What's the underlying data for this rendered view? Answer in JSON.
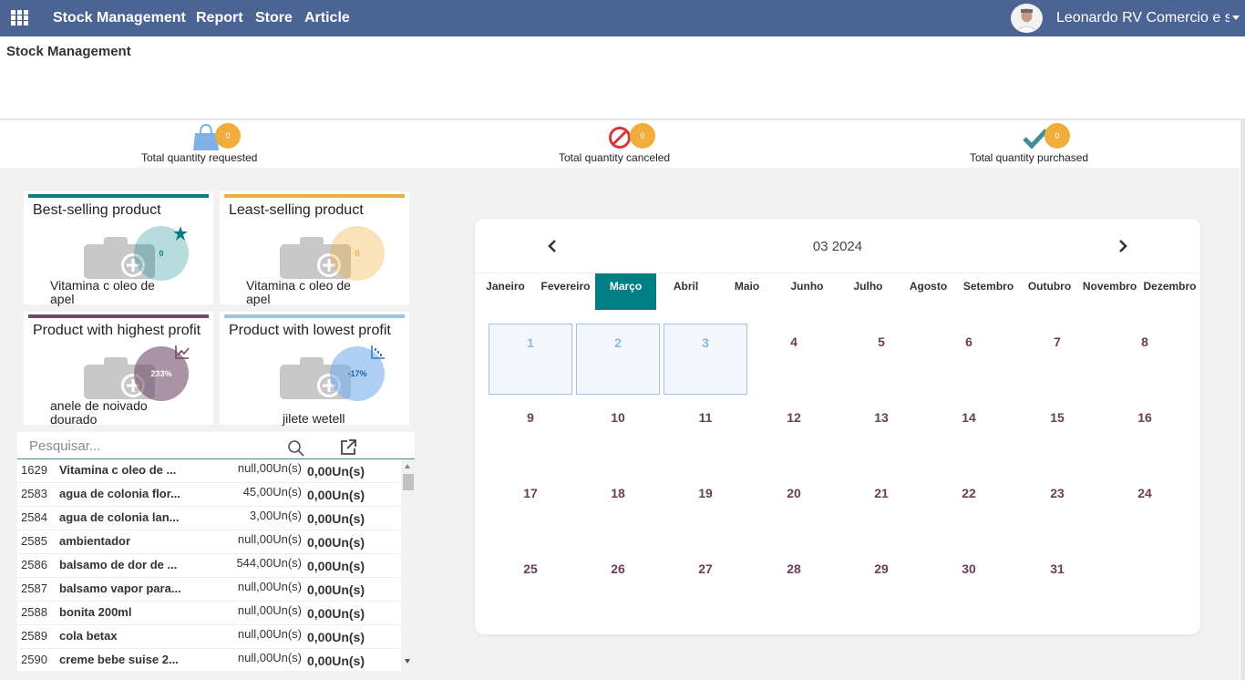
{
  "navbar": {
    "brand": "Stock Management",
    "menus": [
      "Report",
      "Store",
      "Article"
    ],
    "user": "Leonardo RV Comercio e serviços",
    "bg_color": "#4c6494"
  },
  "page": {
    "title": "Stock Management"
  },
  "kpis": [
    {
      "label": "Total quantity requested",
      "value": "0",
      "icon": "shopping-bag-icon"
    },
    {
      "label": "Total quantity canceled",
      "value": "0",
      "icon": "cancel-icon"
    },
    {
      "label": "Total quantity purchased",
      "value": "0",
      "icon": "check-icon"
    }
  ],
  "cards": [
    {
      "title": "Best-selling product",
      "value": "0",
      "product": "Vitamina c oleo de apel",
      "accent": "#017e84",
      "icon": "star-icon"
    },
    {
      "title": "Least-selling product",
      "value": "0",
      "product": "Vitamina c oleo de apel",
      "accent": "#f0ad3c"
    },
    {
      "title": "Product with highest profit",
      "value": "233%",
      "product": "anele de noivado dourado",
      "accent": "#714b67",
      "icon": "line-chart-icon"
    },
    {
      "title": "Product with lowest profit",
      "value": "-17%",
      "product": "jilete wetell",
      "accent": "#9fc3e7",
      "icon": "bar-chart-icon"
    }
  ],
  "search": {
    "placeholder": "Pesquisar..."
  },
  "products": [
    {
      "code": "1629",
      "name": "Vitamina c oleo de ...",
      "qty": "null,00Un(s)",
      "total": "0,00Un(s)"
    },
    {
      "code": "2583",
      "name": "agua de colonia flor...",
      "qty": "45,00Un(s)",
      "total": "0,00Un(s)"
    },
    {
      "code": "2584",
      "name": "agua de colonia lan...",
      "qty": "3,00Un(s)",
      "total": "0,00Un(s)"
    },
    {
      "code": "2585",
      "name": "ambientador",
      "qty": "null,00Un(s)",
      "total": "0,00Un(s)"
    },
    {
      "code": "2586",
      "name": "balsamo de dor de ...",
      "qty": "544,00Un(s)",
      "total": "0,00Un(s)"
    },
    {
      "code": "2587",
      "name": "balsamo vapor para...",
      "qty": "null,00Un(s)",
      "total": "0,00Un(s)"
    },
    {
      "code": "2588",
      "name": "bonita 200ml",
      "qty": "null,00Un(s)",
      "total": "0,00Un(s)"
    },
    {
      "code": "2589",
      "name": "cola betax",
      "qty": "null,00Un(s)",
      "total": "0,00Un(s)"
    },
    {
      "code": "2590",
      "name": "creme bebe suise 2...",
      "qty": "null,00Un(s)",
      "total": "0,00Un(s)"
    }
  ],
  "calendar": {
    "title": "03 2024",
    "months": [
      "Janeiro",
      "Fevereiro",
      "Março",
      "Abril",
      "Maio",
      "Junho",
      "Julho",
      "Agosto",
      "Setembro",
      "Outubro",
      "Novembro",
      "Dezembro"
    ],
    "active_month": "Março",
    "days": [
      "1",
      "2",
      "3",
      "4",
      "5",
      "6",
      "7",
      "8",
      "9",
      "10",
      "11",
      "12",
      "13",
      "14",
      "15",
      "16",
      "17",
      "18",
      "19",
      "20",
      "21",
      "22",
      "23",
      "24",
      "25",
      "26",
      "27",
      "28",
      "29",
      "30",
      "31"
    ],
    "selected_days": [
      "1",
      "2",
      "3"
    ],
    "active_color": "#017e84"
  }
}
